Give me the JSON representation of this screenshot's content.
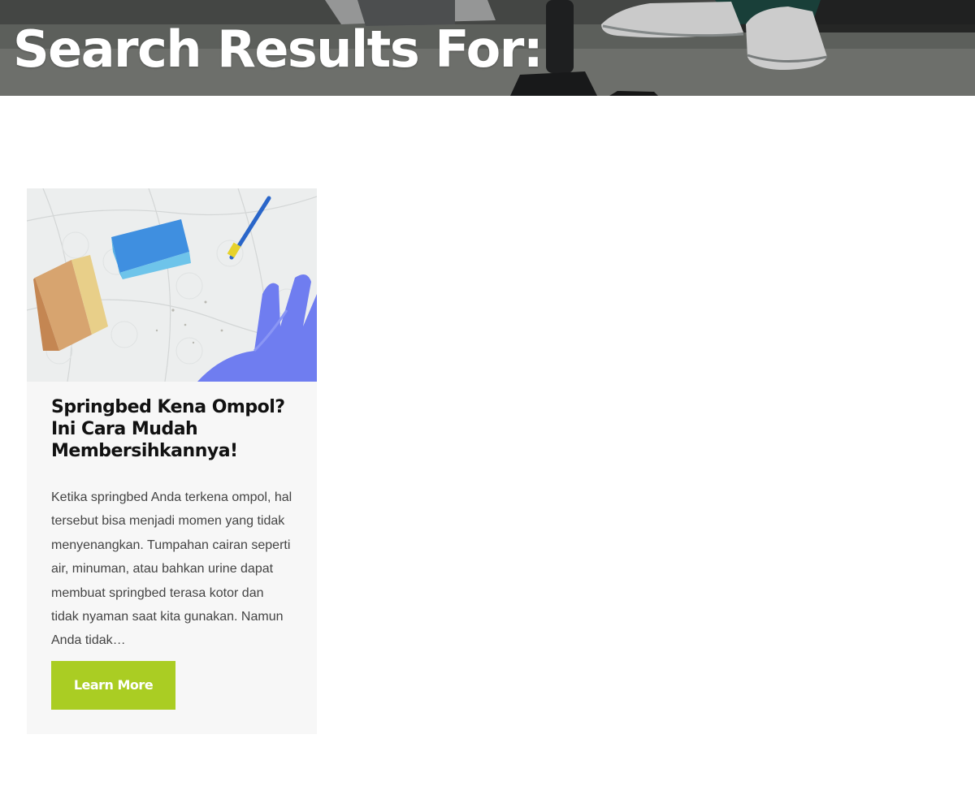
{
  "hero": {
    "title": "Search Results For:"
  },
  "results": [
    {
      "title": "Springbed Kena Ompol? Ini Cara Mudah Membersihkannya!",
      "excerpt": "Ketika springbed Anda terkena ompol, hal tersebut bisa menjadi momen yang tidak menyenangkan. Tumpahan cairan seperti air, minuman, atau bahkan urine dapat membuat springbed terasa kotor dan tidak nyaman saat kita gunakan. Namun Anda tidak…",
      "button_label": "Learn More"
    }
  ],
  "colors": {
    "accent": "#aacd23",
    "card_background": "#f7f7f7",
    "title_text": "#111111",
    "body_text": "#444444"
  }
}
